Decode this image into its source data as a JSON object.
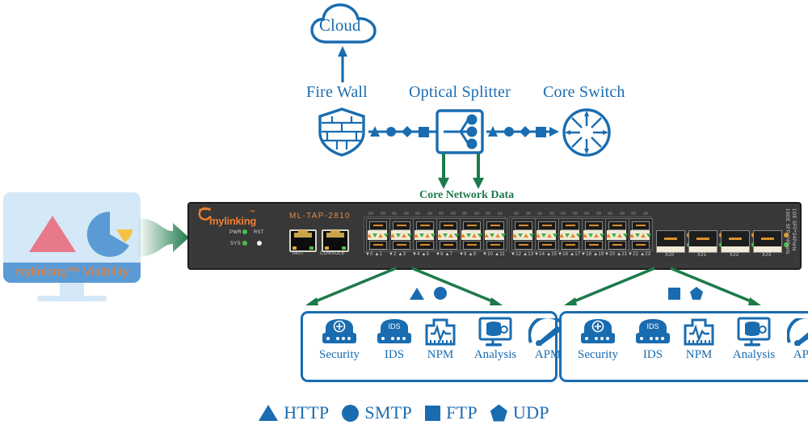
{
  "diagram": {
    "title_nodes": {
      "cloud": "Cloud",
      "firewall": "Fire Wall",
      "optical_splitter": "Optical Splitter",
      "core_switch": "Core Switch"
    },
    "core_data_label": "Core Network Data",
    "colors": {
      "blue": "#1a6cb0",
      "green": "#1d7a4a",
      "orange": "#ed7d31",
      "monitor_bg": "#d4e8f7",
      "monitor_bar": "#5b9bd5",
      "chassis": "#3a3a3a",
      "led_green": "#47c04a",
      "red_triangle": "#e8798a",
      "yellow_wedge": "#f5c344"
    }
  },
  "monitor": {
    "caption": "mylinking™ Visibility",
    "icons": [
      "warning-triangle-icon",
      "pie-chart-icon"
    ]
  },
  "device": {
    "brand": "mylinking",
    "trademark": "™",
    "model": "ML-TAP-2810",
    "leds": [
      {
        "label": "PWR",
        "state": "green"
      },
      {
        "label": "SYS",
        "state": "green"
      }
    ],
    "buttons": [
      {
        "label": "RST",
        "state": "white"
      }
    ],
    "rj45_ports": [
      {
        "label": "MGT"
      },
      {
        "label": "CONSOLE"
      }
    ],
    "sfp_bank_left": {
      "port_numbers": [
        "0",
        "1",
        "2",
        "3",
        "4",
        "5",
        "6",
        "7",
        "8",
        "9",
        "10",
        "11"
      ]
    },
    "sfp_bank_right": {
      "port_numbers": [
        "12",
        "13",
        "14",
        "15",
        "16",
        "17",
        "18",
        "19",
        "20",
        "21",
        "22",
        "23"
      ]
    },
    "tenG_ports": [
      {
        "label": "X20"
      },
      {
        "label": "X21"
      },
      {
        "label": "X22"
      },
      {
        "label": "X23"
      }
    ],
    "side_text_top": "10GE SFP+*4Ports",
    "side_text_bottom": "1GE SFP*24Ports"
  },
  "tool_groups": [
    {
      "id": "left",
      "protocols": [
        "HTTP",
        "SMTP"
      ],
      "protocol_shapes": [
        "triangle",
        "circle"
      ],
      "tools": [
        {
          "label": "Security",
          "icon": "shield-appliance-icon"
        },
        {
          "label": "IDS",
          "icon": "ids-appliance-icon"
        },
        {
          "label": "NPM",
          "icon": "network-monitor-icon"
        },
        {
          "label": "Analysis",
          "icon": "database-analysis-icon"
        },
        {
          "label": "APM",
          "icon": "gauge-icon"
        }
      ]
    },
    {
      "id": "right",
      "protocols": [
        "FTP",
        "UDP"
      ],
      "protocol_shapes": [
        "square",
        "pentagon"
      ],
      "tools": [
        {
          "label": "Security",
          "icon": "shield-appliance-icon"
        },
        {
          "label": "IDS",
          "icon": "ids-appliance-icon"
        },
        {
          "label": "NPM",
          "icon": "network-monitor-icon"
        },
        {
          "label": "Analysis",
          "icon": "database-analysis-icon"
        },
        {
          "label": "APM",
          "icon": "gauge-icon"
        }
      ]
    }
  ],
  "legend": [
    {
      "shape": "triangle",
      "label": "HTTP"
    },
    {
      "shape": "circle",
      "label": "SMTP"
    },
    {
      "shape": "square",
      "label": "FTP"
    },
    {
      "shape": "pentagon",
      "label": "UDP"
    }
  ]
}
